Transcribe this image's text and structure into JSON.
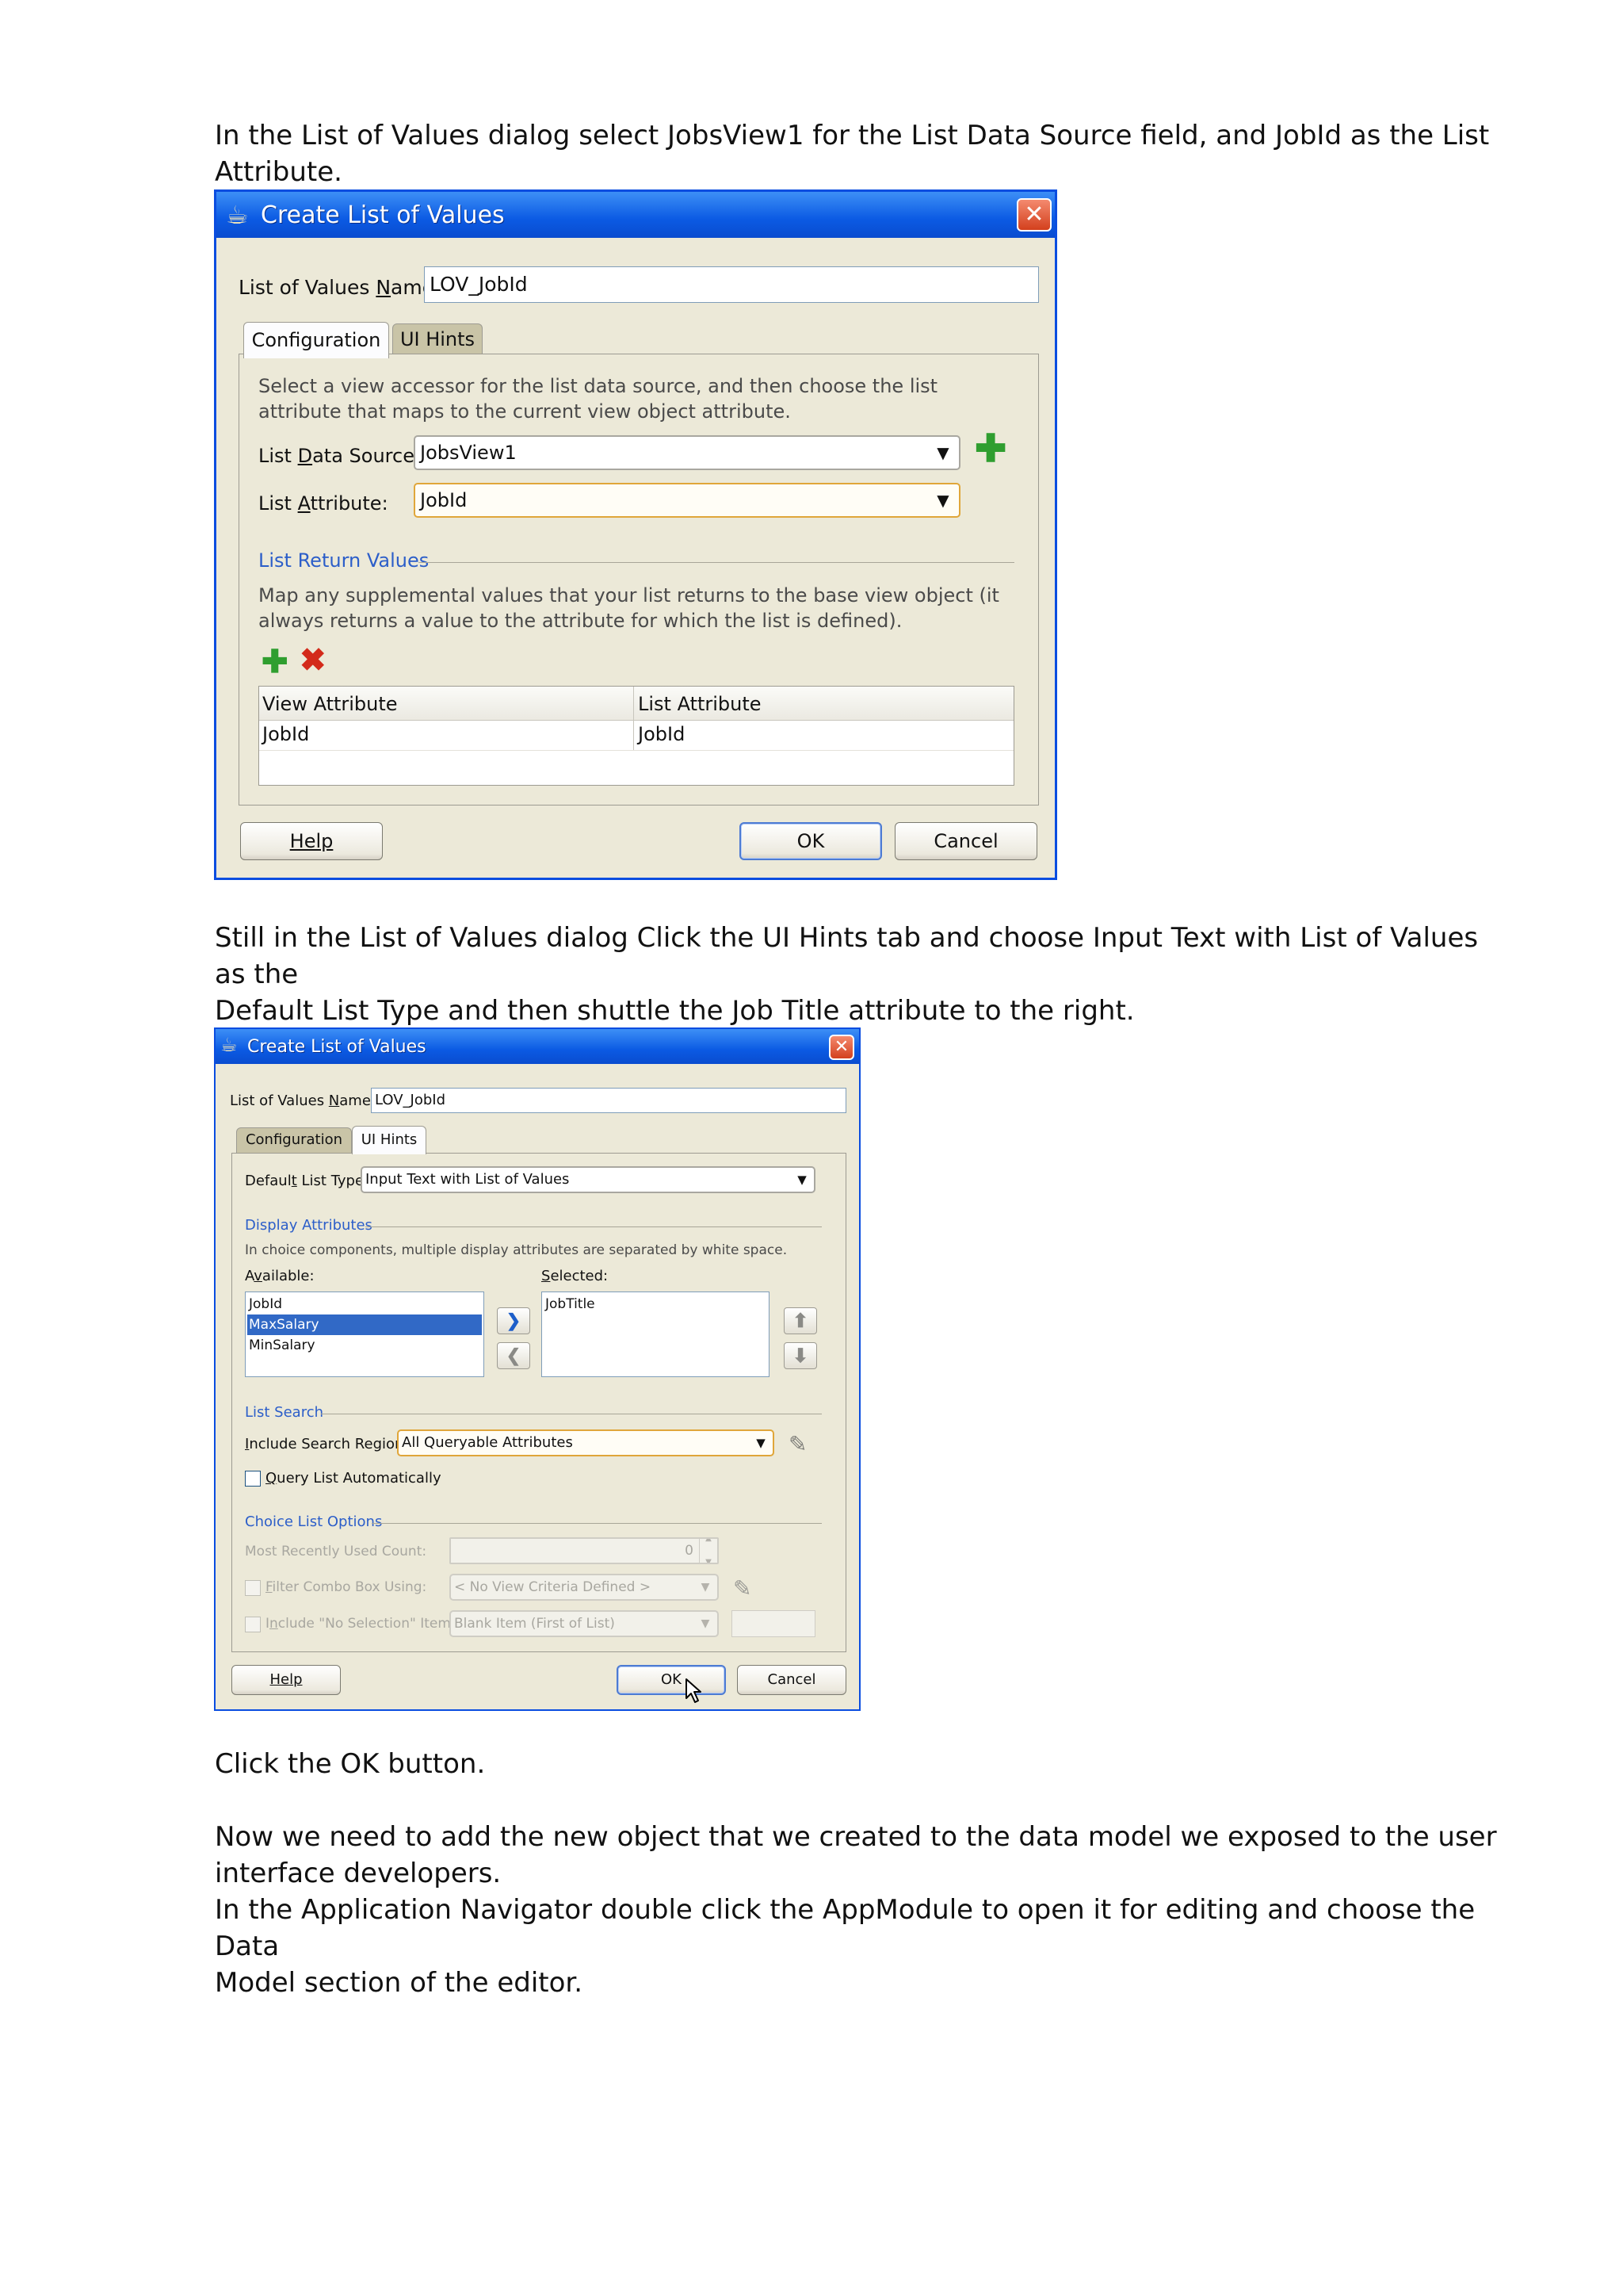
{
  "instructions": {
    "p1": "In the List of Values dialog select JobsView1 for the List Data Source field, and JobId as the List Attribute.",
    "p2_line1": "Still in the List of Values dialog Click the UI Hints tab and choose Input Text with List of Values as the",
    "p2_line2": "Default List Type and then shuttle the Job Title attribute to the right.",
    "p3": "Click the OK button.",
    "p4_line1": "Now we need to add the new object that we created to the data model we exposed to the user",
    "p4_line2": "interface developers.",
    "p5_line1": "In the Application Navigator double click the AppModule to open it for editing and choose the Data",
    "p5_line2": "Model section of the editor."
  },
  "dialog1": {
    "title": "Create List of Values",
    "name_label": "List of Values Name:",
    "name_value": "LOV_JobId",
    "tabs": [
      "Configuration",
      "UI Hints"
    ],
    "description": "Select a view accessor for the list data source, and then choose the list attribute that maps to the current view object attribute.",
    "data_source_label": "List Data Source:",
    "data_source_value": "JobsView1",
    "attribute_label": "List Attribute:",
    "attribute_value": "JobId",
    "return_values_section": "List Return Values",
    "return_values_desc": "Map any supplemental values that your list returns to the base view object (it always returns a value to the attribute for which the list is defined).",
    "table": {
      "columns": [
        "View Attribute",
        "List Attribute"
      ],
      "rows": [
        [
          "JobId",
          "JobId"
        ]
      ]
    },
    "buttons": {
      "help": "Help",
      "ok": "OK",
      "cancel": "Cancel"
    }
  },
  "dialog2": {
    "title": "Create List of Values",
    "name_label": "List of Values Name:",
    "name_value": "LOV_JobId",
    "tabs": [
      "Configuration",
      "UI Hints"
    ],
    "default_list_type_label": "Default List Type:",
    "default_list_type_value": "Input Text with List of Values",
    "display_attributes_section": "Display Attributes",
    "display_attributes_note": "In choice components, multiple display attributes are separated by white space.",
    "available_label": "Available:",
    "selected_label": "Selected:",
    "available_items": [
      "JobId",
      "MaxSalary",
      "MinSalary"
    ],
    "available_selected_index": 1,
    "selected_items": [
      "JobTitle"
    ],
    "list_search_section": "List Search",
    "include_search_label": "Include Search Region:",
    "include_search_value": "All Queryable Attributes",
    "query_auto_label": "Query List Automatically",
    "choice_options_section": "Choice List Options",
    "mru_label": "Most Recently Used Count:",
    "mru_value": "0",
    "filter_label": "Filter Combo Box Using:",
    "filter_value": "< No View Criteria Defined >",
    "no_selection_label": "Include \"No Selection\" Item:",
    "no_selection_value": "Blank Item (First of List)",
    "buttons": {
      "help": "Help",
      "ok": "OK",
      "cancel": "Cancel"
    }
  },
  "colors": {
    "titlebar": "#0b5ae3",
    "dialog_bg": "#ece9d8",
    "section_blue": "#2c5ec9",
    "selection": "#3169c6",
    "add_green": "#2f9e2f",
    "delete_red": "#d32a1a"
  },
  "icons": [
    "coffee-cup-icon",
    "close-icon",
    "add-icon",
    "delete-icon",
    "dropdown-arrow-icon",
    "shuttle-right-icon",
    "shuttle-left-icon",
    "move-up-icon",
    "move-down-icon",
    "edit-pencil-icon",
    "mouse-cursor-icon"
  ]
}
